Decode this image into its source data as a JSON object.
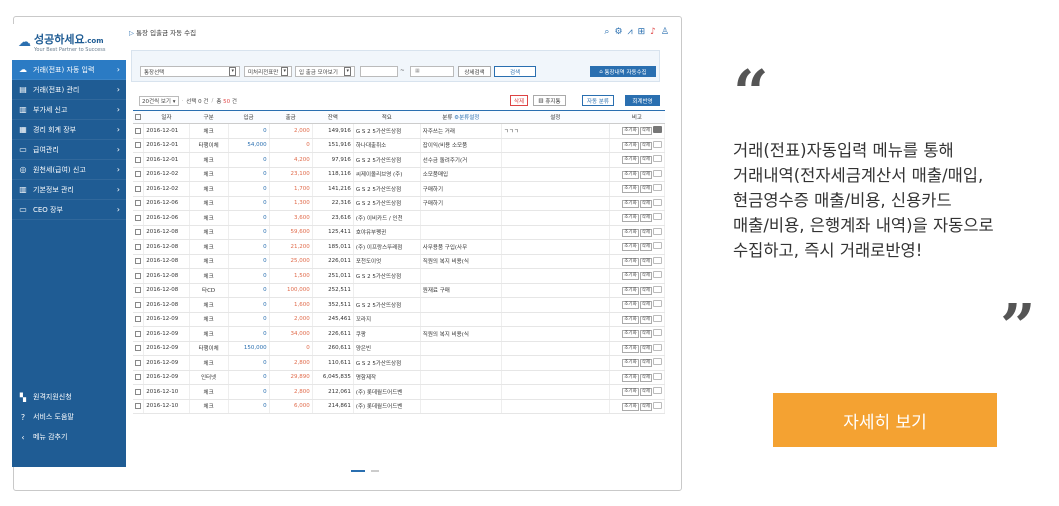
{
  "sidebar": {
    "logo_mark": "☁",
    "brand_main": "성공",
    "brand_sub": "하세요",
    "brand_domain": ".com",
    "tagline": "Your Best Partner to Success",
    "items": [
      {
        "icon": "cloud-icon",
        "glyph": "☁",
        "label": "거래(전표) 자동 입력",
        "active": true
      },
      {
        "icon": "ledger-icon",
        "glyph": "▤",
        "label": "거래(전표) 관리"
      },
      {
        "icon": "tax-icon",
        "glyph": "▥",
        "label": "부가세 신고"
      },
      {
        "icon": "book-icon",
        "glyph": "▦",
        "label": "경리 회계 장부"
      },
      {
        "icon": "salary-icon",
        "glyph": "▭",
        "label": "급여관리"
      },
      {
        "icon": "withholding-icon",
        "glyph": "◎",
        "label": "원천세(급여) 신고"
      },
      {
        "icon": "building-icon",
        "glyph": "▥",
        "label": "기본정보 관리"
      },
      {
        "icon": "monitor-icon",
        "glyph": "▭",
        "label": "CEO 장부"
      }
    ],
    "bottom_items": [
      {
        "icon": "remote-icon",
        "glyph": "▚",
        "label": "원격지원신청"
      },
      {
        "icon": "help-icon",
        "glyph": "?",
        "label": "서비스 도움말"
      },
      {
        "icon": "collapse-icon",
        "glyph": "‹",
        "label": "메뉴 감추기"
      }
    ]
  },
  "topbar": {
    "title_icon": "▷",
    "title": "통장 입출금 자동 수집"
  },
  "filter": {
    "account_select": "통장선택",
    "unprocessed_select": "미처리전표만",
    "view_select": "입 출금 모아보기",
    "date_sep": "~",
    "detail_search": "상세검색",
    "search": "검색",
    "bank_collect": "통장내역 자동수집"
  },
  "info": {
    "page_size": "20건씩 보기",
    "selected_label": "선택",
    "selected_count": "0",
    "selected_unit": "건",
    "total_label": "총",
    "total_count": "50",
    "total_unit": "건",
    "delete": "삭제",
    "trash": "휴지통",
    "auto_classify": "자동 분류",
    "apply": "회계반영"
  },
  "table": {
    "headers": [
      "일자",
      "구분",
      "입금",
      "출금",
      "잔액",
      "적요",
      "분류",
      "분류설정",
      "설정",
      "비고"
    ],
    "row_btn_a": "조기화",
    "row_btn_b": "삭제",
    "rows": [
      {
        "date": "2016-12-01",
        "type": "체크",
        "in": "0",
        "out": "2,000",
        "bal": "149,916",
        "memo": "G S 2 5가산뜨상점",
        "cat": "자주쓰는 거래",
        "set": "ㄱㄱㄱ"
      },
      {
        "date": "2016-12-01",
        "type": "타행이체",
        "in": "54,000",
        "out": "0",
        "bal": "151,916",
        "memo": "하나대출취소",
        "cat": "잡이익(비용 소모품",
        "set": ""
      },
      {
        "date": "2016-12-01",
        "type": "체크",
        "in": "0",
        "out": "4,200",
        "bal": "97,916",
        "memo": "G S 2 5가산뜨상점",
        "cat": "선수금 돌려주기(거",
        "set": ""
      },
      {
        "date": "2016-12-02",
        "type": "체크",
        "in": "0",
        "out": "23,100",
        "bal": "118,116",
        "memo": "씨제이올리브영 (주)",
        "cat": "소모품매입",
        "set": ""
      },
      {
        "date": "2016-12-02",
        "type": "체크",
        "in": "0",
        "out": "1,700",
        "bal": "141,216",
        "memo": "G S 2 5가산뜨상점",
        "cat": "구매하기",
        "set": ""
      },
      {
        "date": "2016-12-06",
        "type": "체크",
        "in": "0",
        "out": "1,300",
        "bal": "22,316",
        "memo": "G S 2 5가산뜨상점",
        "cat": "구매하기",
        "set": ""
      },
      {
        "date": "2016-12-06",
        "type": "체크",
        "in": "0",
        "out": "3,600",
        "bal": "23,616",
        "memo": "(주) 이비카드 / 인천",
        "cat": "",
        "set": ""
      },
      {
        "date": "2016-12-08",
        "type": "체크",
        "in": "0",
        "out": "59,600",
        "bal": "125,411",
        "memo": "호야유부펭귄",
        "cat": "",
        "set": ""
      },
      {
        "date": "2016-12-08",
        "type": "체크",
        "in": "0",
        "out": "21,200",
        "bal": "185,011",
        "memo": "(주) 이프랑스뚜레점",
        "cat": "사무용품 구입(사무",
        "set": ""
      },
      {
        "date": "2016-12-08",
        "type": "체크",
        "in": "0",
        "out": "25,000",
        "bal": "226,011",
        "memo": "포천도이엇",
        "cat": "직원의 복지 비용(식",
        "set": ""
      },
      {
        "date": "2016-12-08",
        "type": "체크",
        "in": "0",
        "out": "1,500",
        "bal": "251,011",
        "memo": "G S 2 5가산뜨상점",
        "cat": "",
        "set": ""
      },
      {
        "date": "2016-12-08",
        "type": "타CD",
        "in": "0",
        "out": "100,000",
        "bal": "252,511",
        "memo": "",
        "cat": "원재료 구매",
        "set": ""
      },
      {
        "date": "2016-12-08",
        "type": "체크",
        "in": "0",
        "out": "1,600",
        "bal": "352,511",
        "memo": "G S 2 5가산뜨상점",
        "cat": "",
        "set": ""
      },
      {
        "date": "2016-12-09",
        "type": "체크",
        "in": "0",
        "out": "2,000",
        "bal": "245,461",
        "memo": "꼬라지",
        "cat": "",
        "set": ""
      },
      {
        "date": "2016-12-09",
        "type": "체크",
        "in": "0",
        "out": "34,000",
        "bal": "226,611",
        "memo": "쿠팡",
        "cat": "직원의 복지 비용(식",
        "set": ""
      },
      {
        "date": "2016-12-09",
        "type": "타행이체",
        "in": "150,000",
        "out": "0",
        "bal": "260,611",
        "memo": "양은빈",
        "cat": "",
        "set": ""
      },
      {
        "date": "2016-12-09",
        "type": "체크",
        "in": "0",
        "out": "2,800",
        "bal": "110,611",
        "memo": "G S 2 5가산뜨상점",
        "cat": "",
        "set": ""
      },
      {
        "date": "2016-12-09",
        "type": "인터넷",
        "in": "0",
        "out": "29,890",
        "bal": "6,045,835",
        "memo": "명함제작",
        "cat": "",
        "set": ""
      },
      {
        "date": "2016-12-10",
        "type": "체크",
        "in": "0",
        "out": "2,800",
        "bal": "212,061",
        "memo": "(주) 롯데월드어드벤",
        "cat": "",
        "set": ""
      },
      {
        "date": "2016-12-10",
        "type": "체크",
        "in": "0",
        "out": "6,000",
        "bal": "214,861",
        "memo": "(주) 롯데월드어드벤",
        "cat": "",
        "set": ""
      }
    ]
  },
  "promo": {
    "open_quote": "“",
    "close_quote": "”",
    "line1": "거래(전표)자동입력 메뉴를 통해",
    "line2": "거래내역(전자세금계산서 매출/매입,",
    "line3": "현금영수증 매출/비용, 신용카드",
    "line4": "매출/비용, 은행계좌 내역)을 자동으로",
    "line5": "수집하고, 즉시 거래로반영!",
    "cta": "자세히 보기"
  },
  "colors": {
    "sidebar": "#1f5c94",
    "accent": "#2a6fb0",
    "cta": "#f4a232"
  }
}
